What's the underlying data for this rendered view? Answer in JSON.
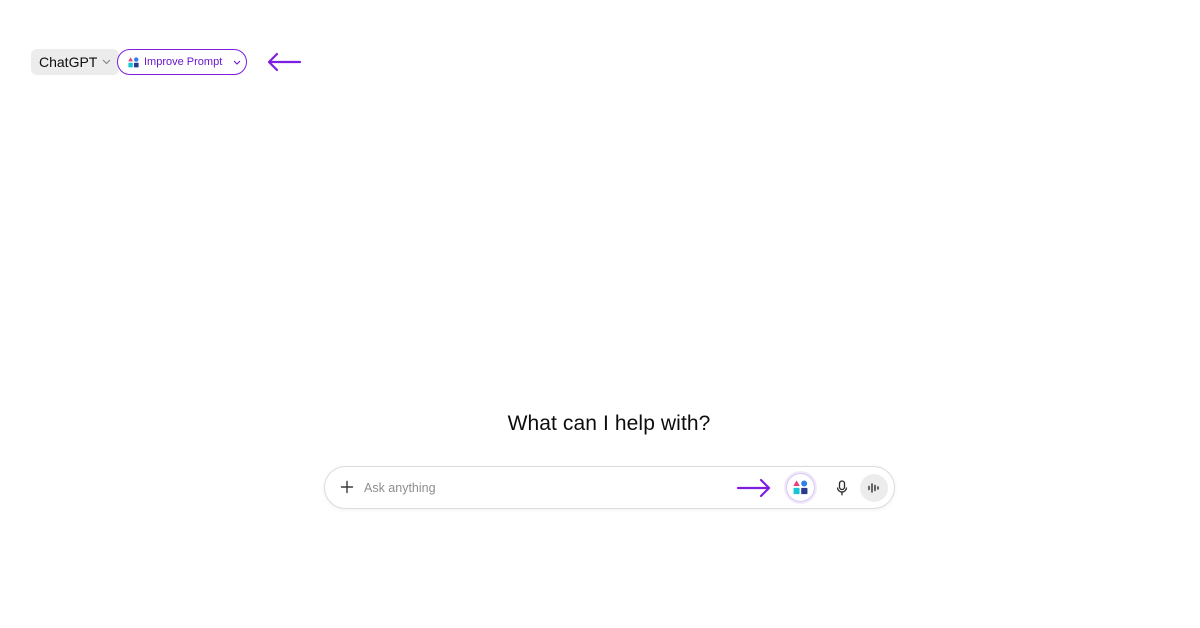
{
  "header": {
    "model_label": "ChatGPT",
    "improve_label": "Improve Prompt"
  },
  "main": {
    "heading": "What can I help with?"
  },
  "composer": {
    "placeholder": "Ask anything",
    "value": ""
  },
  "icons": {
    "model_chevron": "chevron-down-icon",
    "improve_logo": "improve-prompt-logo-icon",
    "improve_chevron": "chevron-down-icon",
    "annotation_left": "arrow-left-icon",
    "plus": "plus-icon",
    "annotation_right": "arrow-right-icon",
    "improve_fab": "improve-prompt-logo-icon",
    "mic": "microphone-icon",
    "voice": "voice-waveform-icon"
  },
  "colors": {
    "accent_purple": "#7c1fe0",
    "logo_pink": "#e8407a",
    "logo_blue": "#2f7ff0",
    "logo_cyan": "#17c6d6",
    "logo_navy": "#2b3a8c",
    "pill_gray": "#ececec"
  }
}
